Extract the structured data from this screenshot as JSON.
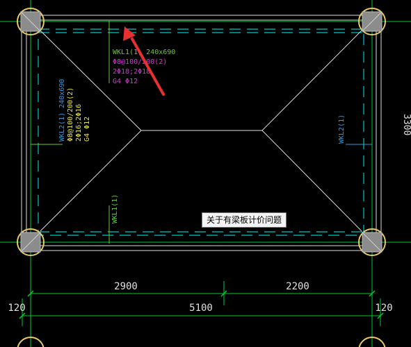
{
  "colors": {
    "background": "#000000",
    "axis": "#00cc33",
    "outline": "#e0e0e0",
    "dashed_beam": "#00c8c8",
    "annotation_green": "#66cc33",
    "annotation_magenta": "#dd33dd",
    "annotation_yellow": "#e6e633",
    "annotation_cyan": "#3399dd",
    "column_fill": "#8c8c8c",
    "column_ring": "#e6cc66",
    "arrow": "#e83030",
    "dim_text": "#e0e0e0"
  },
  "beam_top": {
    "name": "WKL1(1) 240x690",
    "stirrup": "Φ8@100/200(2)",
    "main_bars": "2Φ18;2Φ18",
    "side_bars": "G4 Φ12"
  },
  "beam_left": {
    "name": "WKL2(1) 240x690",
    "stirrup": "Φ8@100/200(2)",
    "main_bars": "2Φ16;2Φ16",
    "side_bars": "G4 Φ12"
  },
  "beam_right_label": "WKL2(1)",
  "beam_bottom_label": "WKL1(1)",
  "right_edge_dim": "3300",
  "dimensions": {
    "span_left": "2900",
    "span_right": "2200",
    "total": "5100",
    "offset_left": "120",
    "offset_right": "120"
  },
  "tooltip": "关于有梁板计价问题",
  "icons": [
    "column-marker-icon",
    "pointer-arrow-icon"
  ]
}
